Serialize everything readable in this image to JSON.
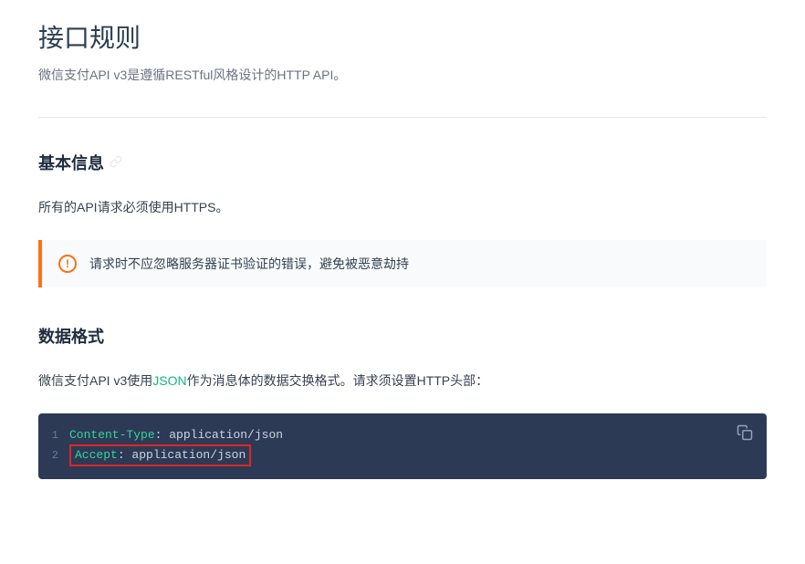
{
  "page": {
    "title": "接口规则",
    "intro": "微信支付API v3是遵循RESTful风格设计的HTTP API。"
  },
  "section_basic": {
    "heading": "基本信息",
    "anchor_char": "🔗",
    "text": "所有的API请求必须使用HTTPS。",
    "callout": "请求时不应忽略服务器证书验证的错误，避免被恶意劫持",
    "callout_icon": "!"
  },
  "section_format": {
    "heading": "数据格式",
    "text_before_link": "微信支付API v3使用",
    "json_link_text": "JSON",
    "text_after_link": "作为消息体的数据交换格式。请求须设置HTTP头部：",
    "code": {
      "line1_key": "Content-Type",
      "line1_sep": ": ",
      "line1_val": "application/json",
      "line2_key": "Accept",
      "line2_sep": ": ",
      "line2_val": "application/json",
      "num1": "1",
      "num2": "2"
    }
  }
}
